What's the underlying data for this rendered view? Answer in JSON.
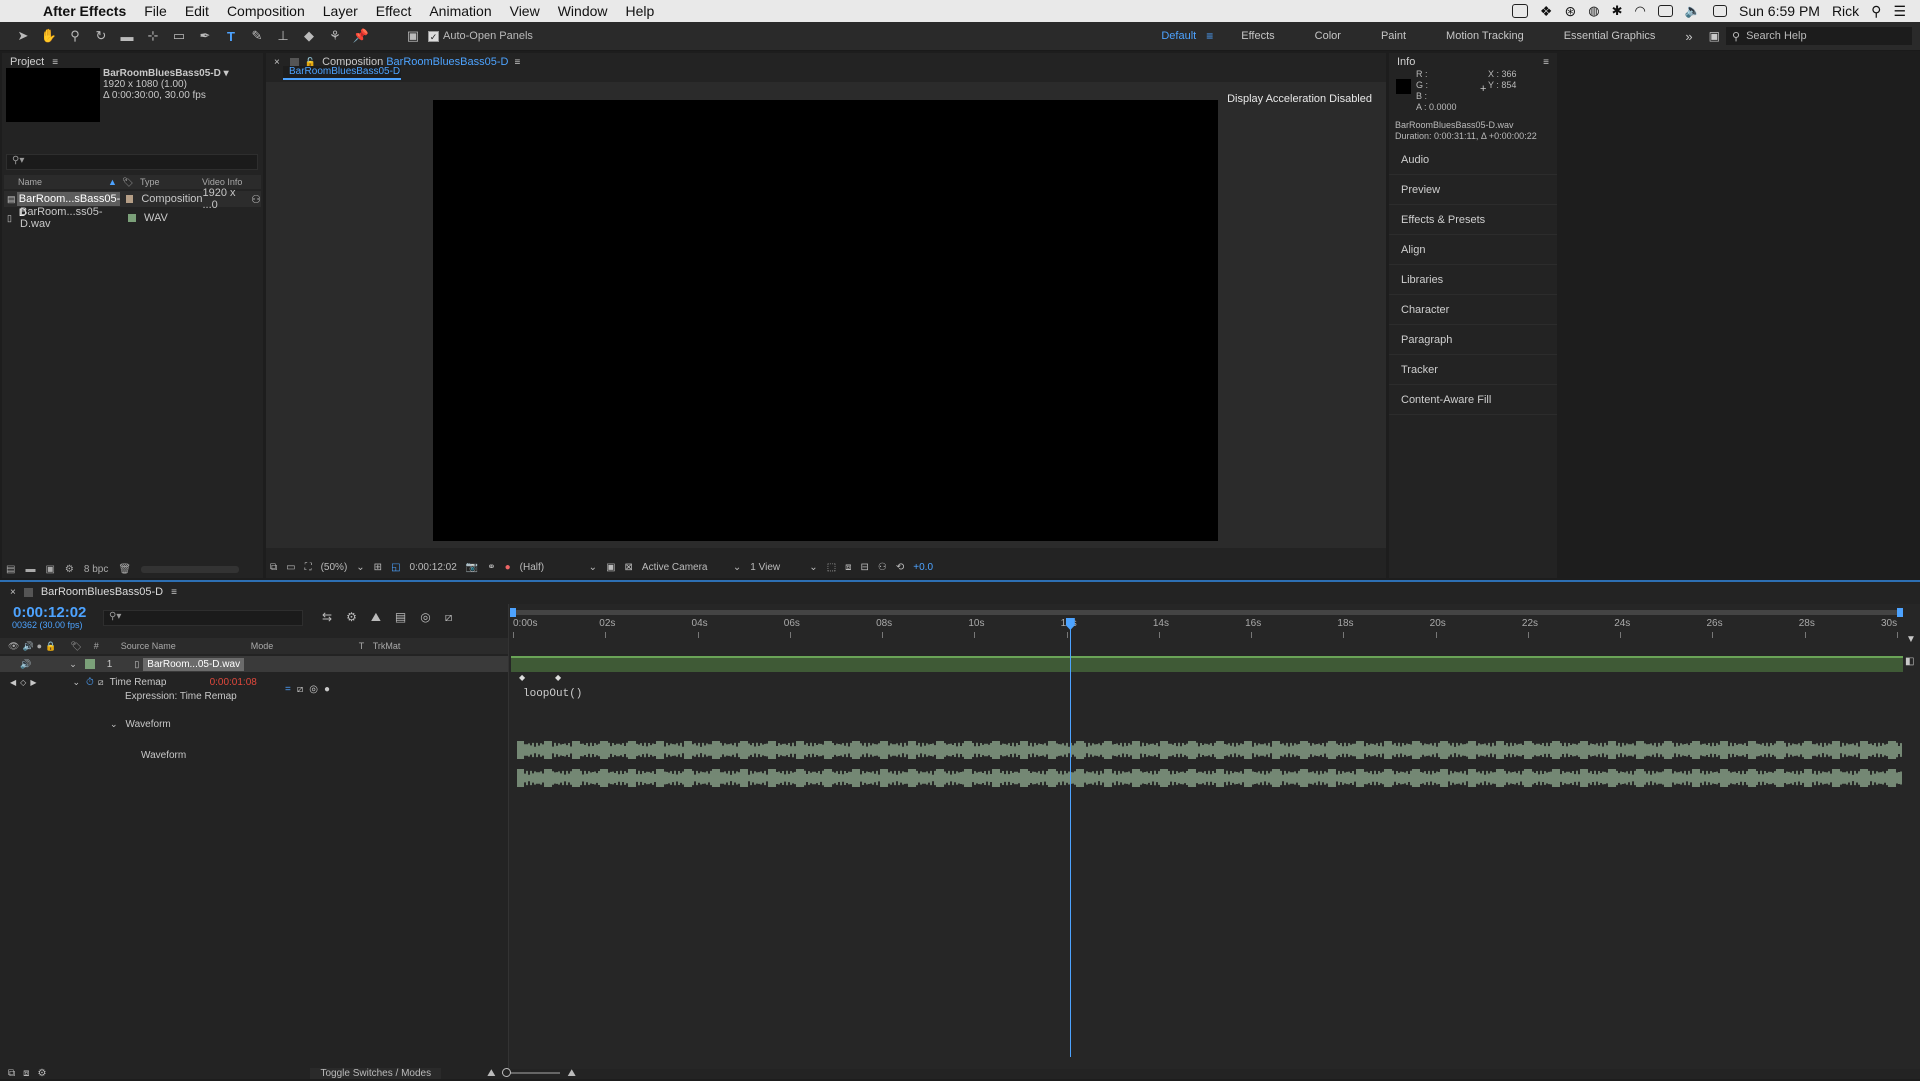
{
  "menubar": {
    "apple": "",
    "app_name": "After Effects",
    "items": [
      "File",
      "Edit",
      "Composition",
      "Layer",
      "Effect",
      "Animation",
      "View",
      "Window",
      "Help"
    ],
    "clock": "Sun 6:59 PM",
    "user": "Rick"
  },
  "toolbar": {
    "auto_open_label": "Auto-Open Panels",
    "workspaces": [
      "Default",
      "Effects",
      "Color",
      "Paint",
      "Motion Tracking",
      "Essential Graphics"
    ],
    "search_placeholder": "Search Help"
  },
  "project": {
    "title": "Project",
    "item_name": "BarRoomBluesBass05-D ▾",
    "item_dims": "1920 x 1080 (1.00)",
    "item_dur": "Δ 0:00:30:00, 30.00 fps",
    "columns": {
      "name": "Name",
      "type": "Type",
      "video": "Video Info"
    },
    "rows": [
      {
        "name": "BarRoom...sBass05-D",
        "type": "Composition",
        "video": "1920 x ...0"
      },
      {
        "name": "BarRoom...ss05-D.wav",
        "type": "WAV",
        "video": ""
      }
    ],
    "bpc": "8 bpc"
  },
  "composition": {
    "tab_prefix": "Composition",
    "tab_name": "BarRoomBluesBass05-D",
    "subtab": "BarRoomBluesBass05-D",
    "notice": "Display Acceleration Disabled",
    "zoom": "(50%)",
    "timecode": "0:00:12:02",
    "resolution": "(Half)",
    "camera": "Active Camera",
    "views": "1 View",
    "exposure": "+0.0"
  },
  "info": {
    "title": "Info",
    "r": "R :",
    "g": "G :",
    "b": "B :",
    "a": "A :  0.0000",
    "x": "X : 366",
    "y": "Y : 854",
    "file": "BarRoomBluesBass05-D.wav",
    "duration": "Duration: 0:00:31:11, Δ +0:00:00:22",
    "panels": [
      "Audio",
      "Preview",
      "Effects & Presets",
      "Align",
      "Libraries",
      "Character",
      "Paragraph",
      "Tracker",
      "Content-Aware Fill"
    ]
  },
  "timeline": {
    "tab": "BarRoomBluesBass05-D",
    "timecode": "0:00:12:02",
    "frames": "00362 (30.00 fps)",
    "columns": {
      "num": "#",
      "source": "Source Name",
      "mode": "Mode",
      "t": "T",
      "trkmat": "TrkMat"
    },
    "layer_num": "1",
    "layer_name": "BarRoom...05-D.wav",
    "time_remap": "Time Remap",
    "time_remap_value": "0:00:01:08",
    "expression_label": "Expression: Time Remap",
    "expression": "loopOut()",
    "waveform_group": "Waveform",
    "waveform_label": "Waveform",
    "toggle": "Toggle Switches / Modes",
    "ruler": [
      "0:00s",
      "02s",
      "04s",
      "06s",
      "08s",
      "10s",
      "12s",
      "14s",
      "16s",
      "18s",
      "20s",
      "22s",
      "24s",
      "26s",
      "28s",
      "30s"
    ],
    "playhead_seconds": 12.07,
    "duration_seconds": 30
  },
  "colors": {
    "accent": "#4da3ff",
    "audio_bar": "#4f8a3f",
    "wave": "#a9c9a9",
    "timecode": "#4da3ff",
    "value_red": "#e0483c"
  }
}
